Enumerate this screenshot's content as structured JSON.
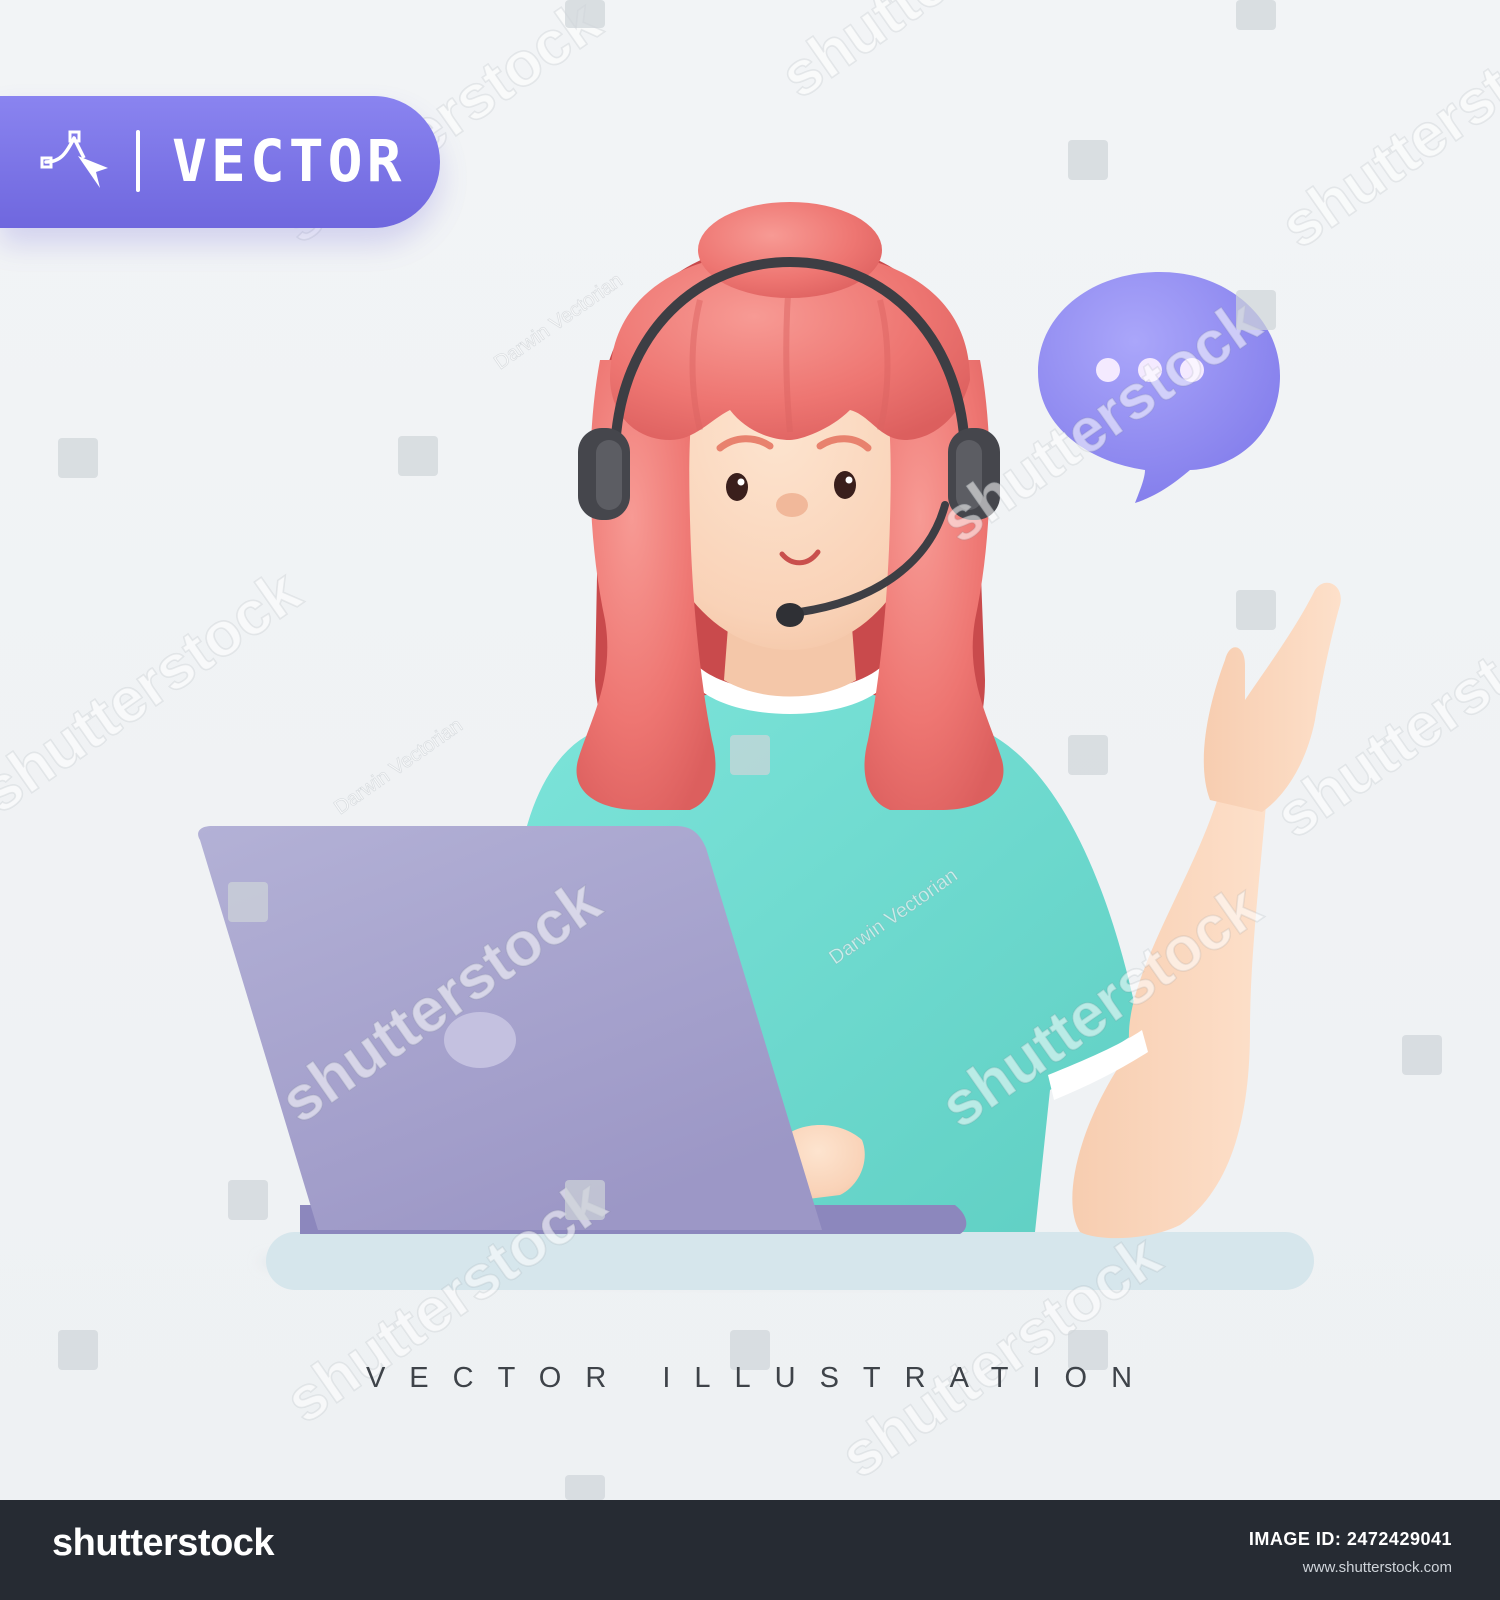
{
  "badge": {
    "label": "VECTOR",
    "icon": "pen-tool-icon",
    "color": "#7a73e6"
  },
  "illustration": {
    "subject": "customer support agent with headset",
    "elements": [
      "woman-figure",
      "headset-icon",
      "laptop",
      "speech-bubble-icon",
      "desk"
    ],
    "colors": {
      "hair": "#ef7a78",
      "shirt": "#74ddd2",
      "skin": "#fbd8c0",
      "laptop": "#a5a3cc",
      "bubble": "#8b86f0",
      "headset": "#4a4a4f",
      "desk": "#d8e8ee"
    }
  },
  "caption": {
    "text": "VECTOR ILLUSTRATION"
  },
  "watermark": {
    "text": "shutterstock",
    "credit": "Darwin Vectorian"
  },
  "footer": {
    "logo": "shutterstock",
    "id_label": "IMAGE ID:",
    "id_value": "2472429041",
    "url": "www.shutterstock.com",
    "background": "#262b33"
  }
}
